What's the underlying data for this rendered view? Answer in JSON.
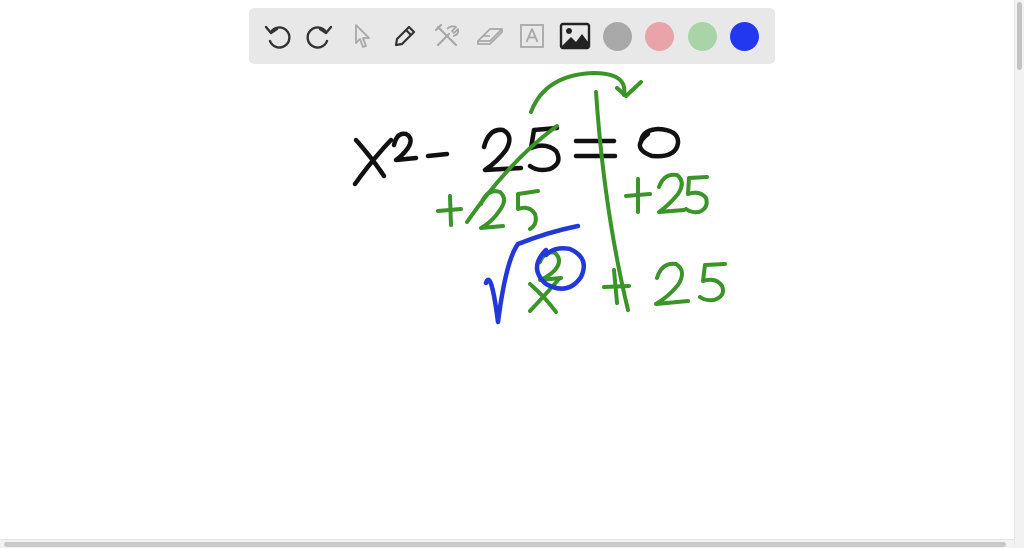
{
  "toolbar": {
    "tools": [
      {
        "name": "undo-icon"
      },
      {
        "name": "redo-icon"
      },
      {
        "name": "pointer-icon"
      },
      {
        "name": "pencil-icon"
      },
      {
        "name": "tools-icon"
      },
      {
        "name": "eraser-icon"
      },
      {
        "name": "text-icon",
        "glyph": "A"
      },
      {
        "name": "image-icon"
      }
    ],
    "colors": [
      "#a8a8a8",
      "#e8a4a8",
      "#a8d4a8",
      "#2238ee"
    ],
    "selected_color": "#2238ee"
  },
  "ink_colors": {
    "black": "#111111",
    "green": "#3a9428",
    "blue": "#2238d8"
  }
}
